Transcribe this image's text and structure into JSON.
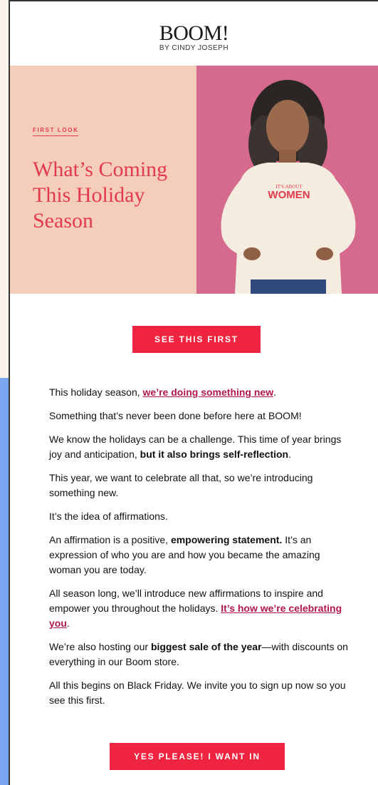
{
  "brand": {
    "name": "BOOM!",
    "sub": "BY CINDY JOSEPH"
  },
  "hero": {
    "kicker": "FIRST LOOK",
    "headline": "What’s Coming This Holiday Season",
    "image_alt": "Smiling woman in a cream sweatshirt",
    "shirt_small": "IT'S ABOUT",
    "shirt_big": "WOMEN"
  },
  "cta_primary": "SEE THIS FIRST",
  "paragraphs": {
    "p1_pre": "This holiday season, ",
    "p1_link": "we’re doing something new",
    "p1_post": ".",
    "p2": "Something that’s never been done before here at BOOM!",
    "p3_pre": "We know the holidays can be a challenge. This time of year brings joy and anticipation, ",
    "p3_bold": "but it also brings self-reflection",
    "p3_post": ".",
    "p4": "This year, we want to celebrate all that, so we’re introducing something new.",
    "p5": "It’s the idea of affirmations.",
    "p6_pre": "An affirmation is a positive, ",
    "p6_bold": "empowering statement.",
    "p6_post": " It’s an expression of who you are and how you became the amazing woman you are today.",
    "p7_pre": "All season long, we’ll introduce new affirmations to inspire and empower you throughout the holidays. ",
    "p7_link": "It’s how we’re celebrating you",
    "p7_post": ".",
    "p8_pre": "We’re also hosting our ",
    "p8_bold": "biggest sale of the year",
    "p8_post": "—with discounts on everything in our Boom store.",
    "p9": "All this begins on Black Friday. We invite you to sign up now so you see this first."
  },
  "cta_secondary": "YES PLEASE! I WANT IN",
  "colors": {
    "accent": "#ef2440",
    "headline": "#e33a4c",
    "link": "#b0174a",
    "hero_left_bg": "#f5cdbb",
    "hero_right_bg": "#d56a8e"
  }
}
